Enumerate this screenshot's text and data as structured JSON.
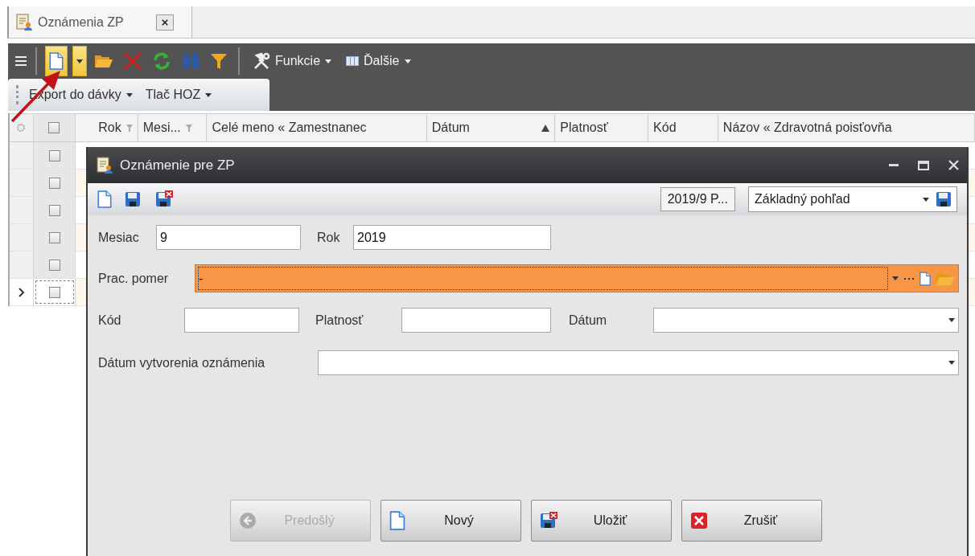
{
  "tabs": [
    {
      "label": "Oznámenia ZP",
      "selected": true
    }
  ],
  "toolbar": {
    "items": [
      {
        "kind": "new",
        "highlighted": true
      },
      {
        "kind": "dropdown",
        "highlighted": true
      },
      {
        "kind": "open",
        "highlighted": false
      },
      {
        "kind": "delete",
        "highlighted": false
      },
      {
        "kind": "refresh",
        "highlighted": false
      },
      {
        "kind": "find",
        "highlighted": false
      },
      {
        "kind": "filter",
        "highlighted": false
      }
    ],
    "menus": [
      {
        "kind": "tools",
        "label": "Funkcie"
      },
      {
        "kind": "columns",
        "label": "Ďalšie"
      }
    ]
  },
  "subtoolbar": {
    "menus": [
      "Export do dávky",
      "Tlač HOZ"
    ]
  },
  "grid": {
    "header_checked": false,
    "columns": [
      {
        "label": "Rok",
        "filter": true,
        "sorted": false
      },
      {
        "label": "Mesi...",
        "filter": true,
        "sorted": false
      },
      {
        "label": "Celé meno « Zamestnanec",
        "filter": false,
        "sorted": false
      },
      {
        "label": "Dátum",
        "filter": false,
        "sorted": true
      },
      {
        "label": "Platnosť",
        "filter": false,
        "sorted": false
      },
      {
        "label": "Kód",
        "filter": false,
        "sorted": false
      },
      {
        "label": "Názov « Zdravotná poisťovňa",
        "filter": false,
        "sorted": false
      }
    ],
    "rows": [
      {
        "checked": false,
        "selected": false
      },
      {
        "checked": false,
        "selected": false
      },
      {
        "checked": false,
        "selected": false
      },
      {
        "checked": false,
        "selected": false
      },
      {
        "checked": false,
        "selected": false
      },
      {
        "checked": false,
        "selected": true
      }
    ]
  },
  "dialog": {
    "title": "Oznámenie pre ZP",
    "period": "2019/9 P...",
    "view": "Základný pohľad",
    "rows": [
      [
        {
          "label": "Mesiac",
          "value": "9",
          "kind": "text"
        },
        {
          "label": "Rok",
          "value": "2019",
          "kind": "text"
        }
      ],
      [
        {
          "label": "Prac. pomer",
          "value": "-",
          "kind": "lookup",
          "highlighted": true
        }
      ],
      [
        {
          "label": "Kód",
          "kind": "text"
        },
        {
          "label": "Platnosť",
          "kind": "text"
        },
        {
          "label": "Dátum",
          "kind": "combo"
        }
      ],
      [
        {
          "label": "Dátum vytvorenia oznámenia",
          "kind": "combo"
        }
      ]
    ],
    "buttons": [
      {
        "label": "Predošlý",
        "kind": "previous",
        "disabled": true
      },
      {
        "label": "Nový",
        "kind": "new",
        "disabled": false
      },
      {
        "label": "Uložiť",
        "kind": "save",
        "disabled": false
      },
      {
        "label": "Zrušiť",
        "kind": "cancel",
        "disabled": false
      }
    ]
  }
}
